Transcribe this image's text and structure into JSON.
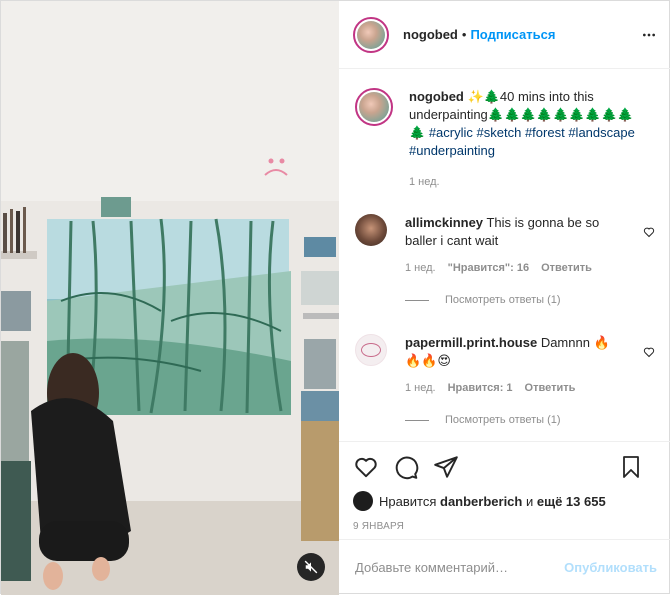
{
  "header": {
    "username": "nogobed",
    "separator": "•",
    "follow_label": "Подписаться",
    "more_icon": "more-horizontal-icon"
  },
  "caption": {
    "username": "nogobed",
    "text_before": " ✨🌲40 mins into this underpainting🌲🌲🌲🌲🌲🌲🌲🌲🌲🌲 ",
    "hashtags": [
      "#acrylic",
      "#sketch",
      "#forest",
      "#landscape",
      "#underpainting"
    ],
    "time": "1 нед."
  },
  "comments": [
    {
      "username": "allimckinney",
      "text": "This is gonna be so baller i cant wait",
      "time": "1 нед.",
      "likes": "\"Нравится\": 16",
      "reply_label": "Ответить",
      "view_replies": "Посмотреть ответы (1)"
    },
    {
      "username": "papermill.print.house",
      "text": "Damnnn 🔥🔥🔥😍",
      "time": "1 нед.",
      "likes": "Нравится: 1",
      "reply_label": "Ответить",
      "view_replies": "Посмотреть ответы (1)"
    }
  ],
  "actions": {
    "like_icon": "heart-icon",
    "comment_icon": "comment-icon",
    "share_icon": "send-icon",
    "save_icon": "bookmark-icon"
  },
  "likes_line": {
    "prefix": "Нравится",
    "user": "danberberich",
    "middle": "и",
    "count": "ещё 13 655"
  },
  "date": "9 ЯНВАРЯ",
  "composer": {
    "placeholder": "Добавьте комментарий…",
    "publish_label": "Опубликовать"
  },
  "colors": {
    "accent": "#0095f6",
    "tag": "#00376b",
    "muted": "#8e8e8e",
    "publish_disabled": "#b2dffc"
  }
}
